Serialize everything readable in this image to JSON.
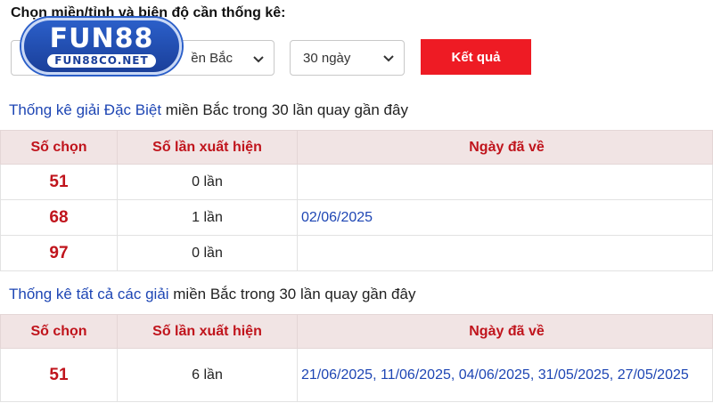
{
  "heading": "Chọn miền/tỉnh và biên độ cần thống kê:",
  "logo": {
    "main": "FUN88",
    "sub": "FUN88CO.NET"
  },
  "filters": {
    "region_value": "ền Bắc",
    "days_value": "30 ngày",
    "submit_label": "Kết quả"
  },
  "section1": {
    "title_link": "Thống kê giải Đặc Biệt",
    "title_rest": " miền Bắc trong 30 lần quay gần đây",
    "headers": [
      "Số chọn",
      "Số lần xuất hiện",
      "Ngày đã về"
    ],
    "rows": [
      {
        "number": "51",
        "count": "0 lần",
        "dates": ""
      },
      {
        "number": "68",
        "count": "1 lần",
        "dates": "02/06/2025"
      },
      {
        "number": "97",
        "count": "0 lần",
        "dates": ""
      }
    ]
  },
  "section2": {
    "title_link": "Thống kê tất cả các giải",
    "title_rest": " miền Bắc trong 30 lần quay gần đây",
    "headers": [
      "Số chọn",
      "Số lần xuất hiện",
      "Ngày đã về"
    ],
    "rows": [
      {
        "number": "51",
        "count": "6 lần",
        "dates": "21/06/2025, 11/06/2025, 04/06/2025, 31/05/2025, 27/05/2025"
      }
    ]
  },
  "colors": {
    "accent_red": "#ee1b24",
    "link_blue": "#1e46b4",
    "header_bg": "#f1e4e4",
    "logo_blue": "#1a3f9a"
  },
  "icons": {
    "select_arrow": "chevron-down-icon"
  }
}
